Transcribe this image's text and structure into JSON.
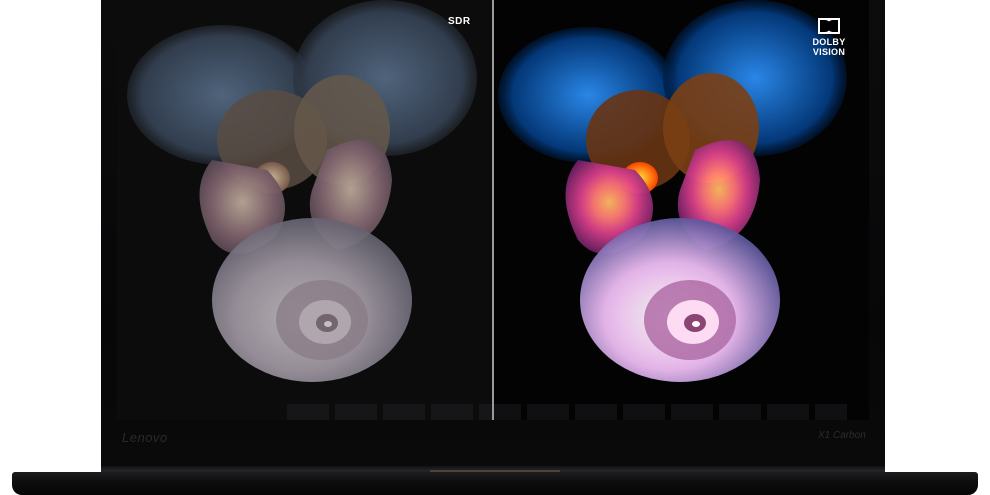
{
  "comparison": {
    "left_label": "SDR",
    "right_badge": {
      "icon": "dolby-double-d-icon",
      "line1": "DOLBY",
      "line2": "VISION"
    }
  },
  "laptop": {
    "brand_left": "Lenovo",
    "brand_right": "X1 Carbon"
  },
  "colors": {
    "bezel": "#0a0a0b",
    "background": "#ffffff",
    "divider": "#9a9a9c"
  }
}
